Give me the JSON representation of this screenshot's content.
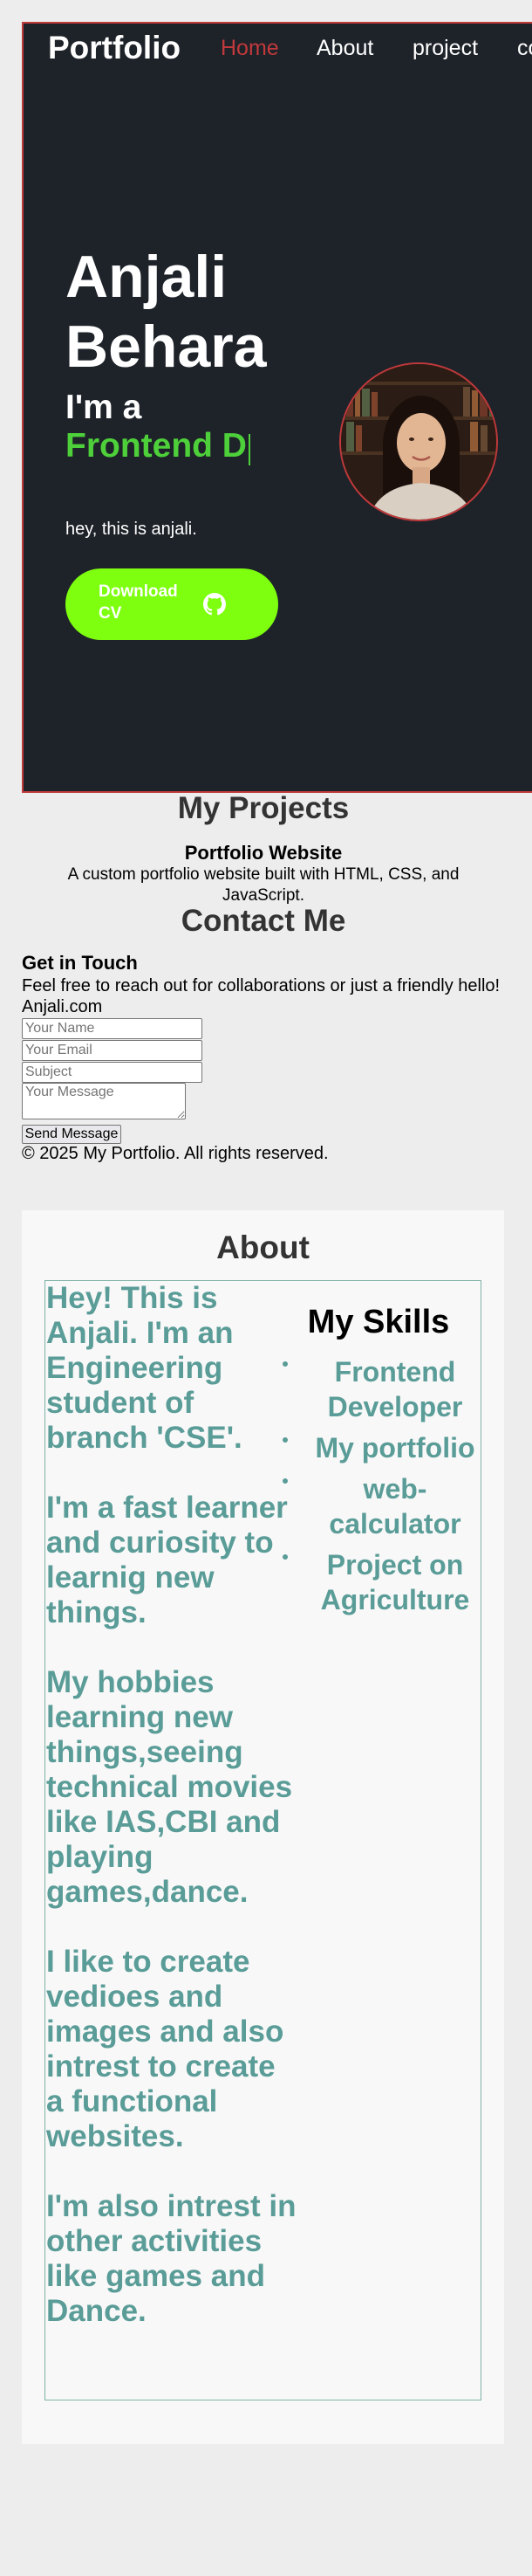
{
  "nav": {
    "logo": "Portfolio",
    "links": [
      "Home",
      "About",
      "project",
      "contact"
    ]
  },
  "hero": {
    "name": "Anjali Behara",
    "iam": "I'm a",
    "typed_text": "Frontend D",
    "subtitle": "hey, this is anjali.",
    "cv_button": "Download CV"
  },
  "projects": {
    "title": "My Projects",
    "items": [
      {
        "name": "Portfolio Website",
        "description": "A custom portfolio website built with HTML, CSS, and JavaScript."
      }
    ]
  },
  "contact": {
    "title": "Contact Me",
    "heading": "Get in Touch",
    "message": "Feel free to reach out for collaborations or just a friendly hello!",
    "name": "Anjali.com",
    "placeholders": {
      "name": "Your Name",
      "email": "Your Email",
      "subject": "Subject",
      "message": "Your Message"
    },
    "send_button": "Send Message"
  },
  "footer": {
    "text": "© 2025 My Portfolio. All rights reserved."
  },
  "about": {
    "title": "About",
    "paragraphs": [
      "Hey! This is Anjali. I'm an Engineering student of branch 'CSE'.",
      "I'm a fast learner and curiosity to learnig new things.",
      "My hobbies learning new things,seeing technical movies like IAS,CBI and playing games,dance.",
      "I like to create vedioes and images and also intrest to create a functional websites.",
      "I'm also intrest in other activities like games and Dance."
    ],
    "skills_title": "My Skills",
    "skills": [
      "Frontend Developer",
      "My portfolio",
      "web-calculator",
      "Project on Agriculture"
    ]
  },
  "colors": {
    "hero_bg": "#1e2229",
    "accent_red": "#c0393b",
    "typed_green": "#4ed03a",
    "button_green": "#7eff0f",
    "about_teal": "#5a9c97"
  },
  "icons": {
    "cv_button_icon": "github-icon"
  }
}
